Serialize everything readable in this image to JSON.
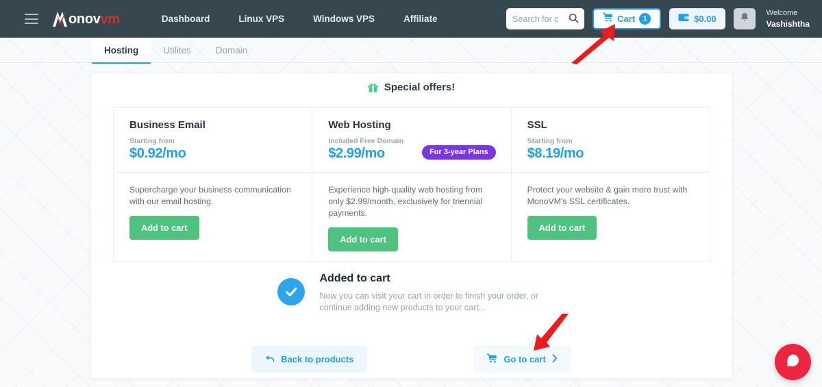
{
  "header": {
    "logo": {
      "icon": "monovm-logo-icon",
      "text_white": "onov",
      "text_red": "vm",
      "text_full": "Monovm"
    },
    "menu_icon": "hamburger-menu-icon",
    "nav": [
      {
        "label": "Dashboard"
      },
      {
        "label": "Linux VPS"
      },
      {
        "label": "Windows VPS"
      },
      {
        "label": "Affiliate"
      }
    ],
    "search": {
      "placeholder": "Search for c",
      "value": "",
      "icon": "search-icon"
    },
    "cart": {
      "label": "Cart",
      "count": "1",
      "icon": "shopping-cart-icon",
      "accent": "#1e9ff2"
    },
    "wallet": {
      "amount": "$0.00",
      "icon": "wallet-icon"
    },
    "notification": {
      "icon": "bell-icon"
    },
    "user": {
      "greeting": "Welcome",
      "name": "Vashishtha"
    }
  },
  "tabs": [
    {
      "label": "Hosting",
      "active": true
    },
    {
      "label": "Utilites",
      "active": false
    },
    {
      "label": "Domain",
      "active": false
    }
  ],
  "main": {
    "special_offers_title": "Special offers!",
    "gift_icon": "gift-icon",
    "products": [
      {
        "title": "Business Email",
        "sub_label": "Starting from",
        "price": "$0.92/mo",
        "badge": "",
        "description": "Supercharge your business communication with our email hosting.",
        "button": "Add to cart"
      },
      {
        "title": "Web Hosting",
        "sub_label": "Included Free Domain",
        "price": "$2.99/mo",
        "badge": "For 3-year Plans",
        "description": "Experience high-quality web hosting from only $2.99/month, exclusively for triennial payments.",
        "button": "Add to cart"
      },
      {
        "title": "SSL",
        "sub_label": "Starting from",
        "price": "$8.19/mo",
        "badge": "",
        "description": "Protect your website & gain more trust with MonoVM's SSL certificates.",
        "button": "Add to cart"
      }
    ],
    "added": {
      "check_icon": "check-circle-icon",
      "title": "Added to cart",
      "description": "Now you can visit your cart in order to finish your order, or continue adding new products to your cart..."
    },
    "actions": {
      "back": {
        "label": "Back to products",
        "icon": "arrow-back-icon"
      },
      "go_to_cart": {
        "label": "Go to cart",
        "icon": "shopping-cart-icon",
        "chevron": "chevron-right-icon"
      }
    }
  },
  "chat": {
    "icon": "chat-bubble-icon",
    "color": "#ef2540"
  },
  "annotations": [
    {
      "name": "arrow-to-cart-button",
      "color": "#ef1b1b"
    },
    {
      "name": "arrow-to-go-to-cart-button",
      "color": "#ef1b1b"
    }
  ],
  "colors": {
    "header_bg": "#37474f",
    "accent_blue": "#1e9ff2",
    "green": "#4cc47f",
    "purple": "#7b35e8",
    "red": "#ef2540"
  }
}
